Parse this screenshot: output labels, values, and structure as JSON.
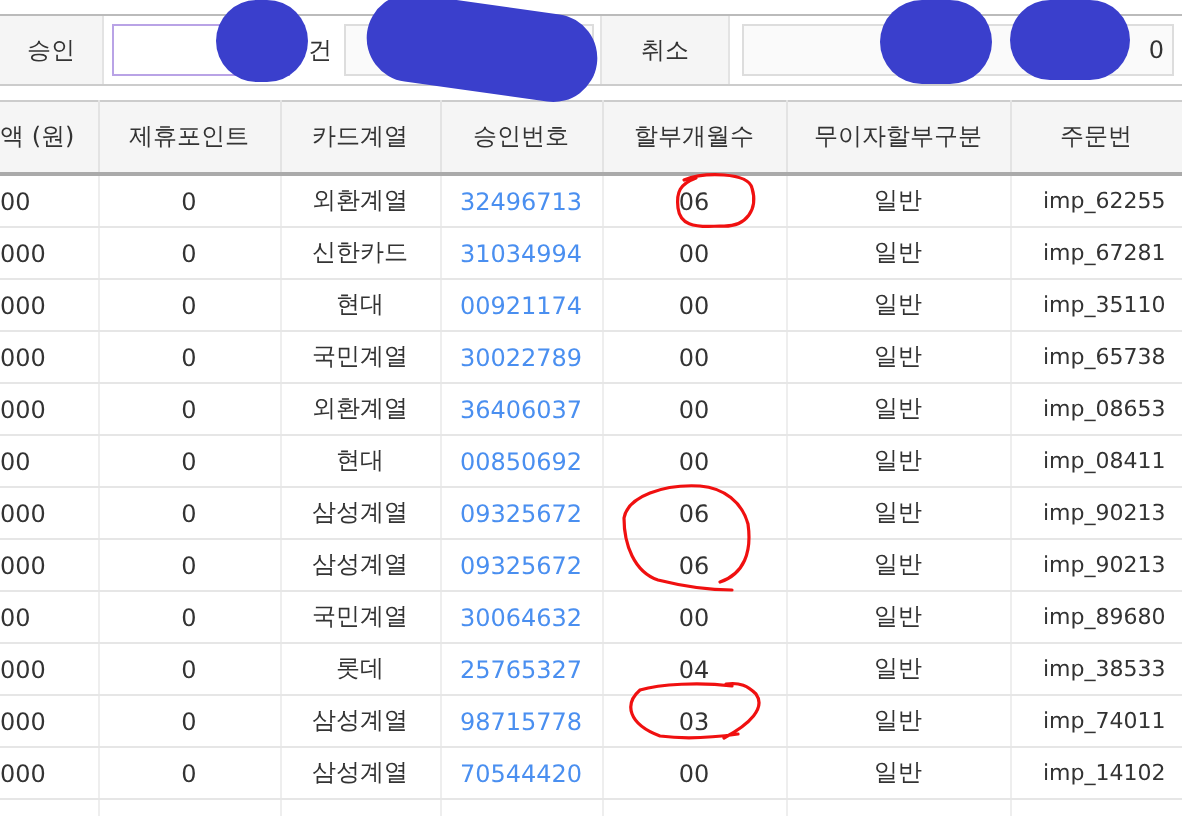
{
  "filter_bar": {
    "approved": {
      "label": "승인",
      "unit": "건"
    },
    "cancelled": {
      "label": "취소",
      "value": "0"
    }
  },
  "table": {
    "columns": [
      "액 (원)",
      "제휴포인트",
      "카드계열",
      "승인번호",
      "할부개월수",
      "무이자할부구분",
      "주문번"
    ],
    "rows": [
      [
        "00",
        "0",
        "외환계열",
        "32496713",
        "06",
        "일반",
        "imp_62255"
      ],
      [
        "000",
        "0",
        "신한카드",
        "31034994",
        "00",
        "일반",
        "imp_67281"
      ],
      [
        "000",
        "0",
        "현대",
        "00921174",
        "00",
        "일반",
        "imp_35110"
      ],
      [
        "000",
        "0",
        "국민계열",
        "30022789",
        "00",
        "일반",
        "imp_65738"
      ],
      [
        "000",
        "0",
        "외환계열",
        "36406037",
        "00",
        "일반",
        "imp_08653"
      ],
      [
        "00",
        "0",
        "현대",
        "00850692",
        "00",
        "일반",
        "imp_08411"
      ],
      [
        "000",
        "0",
        "삼성계열",
        "09325672",
        "06",
        "일반",
        "imp_90213"
      ],
      [
        "000",
        "0",
        "삼성계열",
        "09325672",
        "06",
        "일반",
        "imp_90213"
      ],
      [
        "00",
        "0",
        "국민계열",
        "30064632",
        "00",
        "일반",
        "imp_89680"
      ],
      [
        "000",
        "0",
        "롯데",
        "25765327",
        "04",
        "일반",
        "imp_38533"
      ],
      [
        "000",
        "0",
        "삼성계열",
        "98715778",
        "03",
        "일반",
        "imp_74011"
      ],
      [
        "000",
        "0",
        "삼성계열",
        "70544420",
        "00",
        "일반",
        "imp_14102"
      ]
    ]
  },
  "annotations": [
    {
      "kind": "circle"
    },
    {
      "kind": "circle"
    },
    {
      "kind": "circle"
    }
  ],
  "redactions": [
    {
      "kind": "scribble"
    },
    {
      "kind": "scribble"
    },
    {
      "kind": "scribble"
    },
    {
      "kind": "scribble"
    }
  ]
}
